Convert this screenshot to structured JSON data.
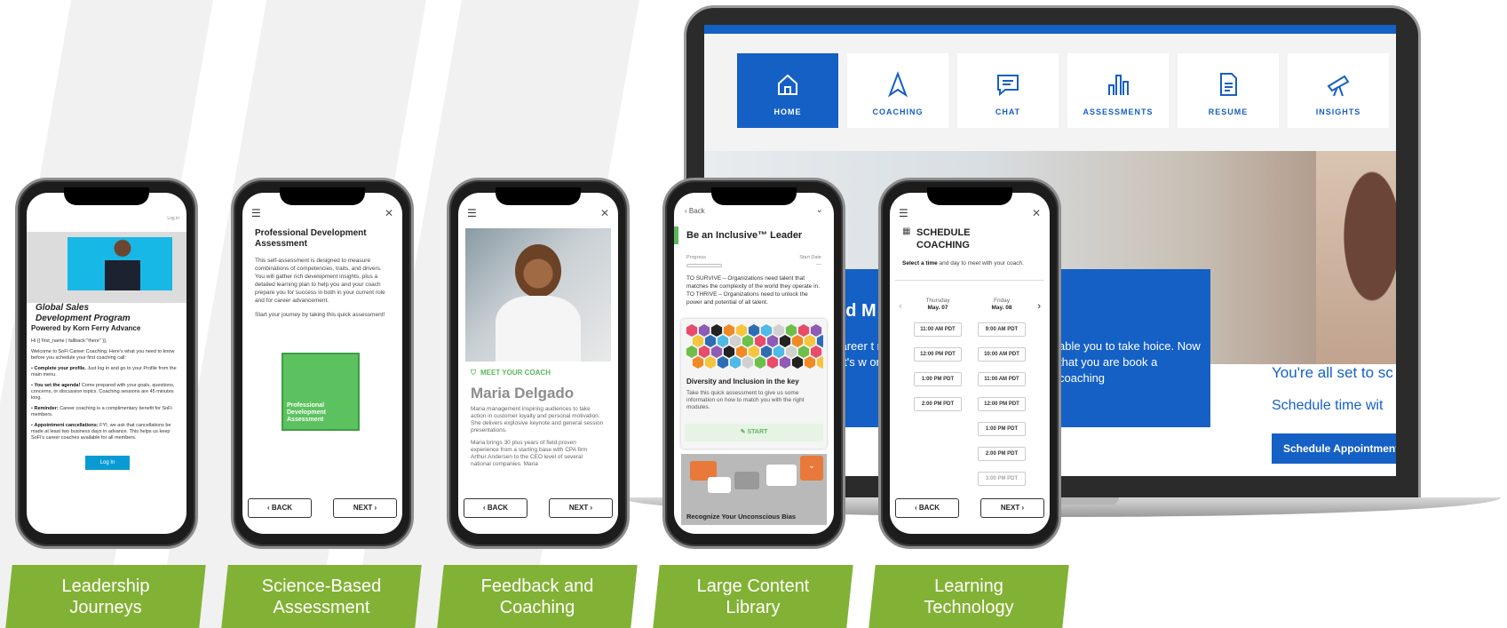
{
  "captions": [
    {
      "line1": "Leadership",
      "line2": "Journeys"
    },
    {
      "line1": "Science-Based",
      "line2": "Assessment"
    },
    {
      "line1": "Feedback and",
      "line2": "Coaching"
    },
    {
      "line1": "Large Content",
      "line2": "Library"
    },
    {
      "line1": "Learning",
      "line2": "Technology"
    }
  ],
  "laptop": {
    "nav": [
      {
        "label": "HOME",
        "icon": "home-icon"
      },
      {
        "label": "COACHING",
        "icon": "navigation-arrow-icon"
      },
      {
        "label": "CHAT",
        "icon": "chat-icon"
      },
      {
        "label": "ASSESSMENTS",
        "icon": "bar-chart-icon"
      },
      {
        "label": "RESUME",
        "icon": "document-icon"
      },
      {
        "label": "INSIGHTS",
        "icon": "telescope-icon"
      }
    ],
    "panel_heading": "od M",
    "panel_left": "career t ningful let's w on, sta",
    "panel_right": "able you to take hoice. Now that you are book a coaching",
    "allset": "You're all set to sc",
    "schedule_time": "Schedule time wit",
    "schedule_button": "Schedule Appointment"
  },
  "phone1": {
    "login_link": "Log in",
    "title_line1": "Global Sales",
    "title_line2": "Development Program",
    "subtitle": "Powered by Korn Ferry Advance",
    "greeting": "Hi {{ first_name | fallback:\"there\" }},",
    "welcome": "Welcome to SoFi Career Coaching. Here's what you need to know before you schedule your first coaching call:",
    "items": [
      {
        "bold": "Complete your profile.",
        "text": " Just log in and go to your Profile from the main menu."
      },
      {
        "bold": "You set the agenda!",
        "text": " Come prepared with your goals, questions, concerns, or discussion topics. Coaching sessions are 45 minutes long."
      },
      {
        "bold": "Reminder:",
        "text": " Career coaching is a complimentary benefit for SoFi members."
      },
      {
        "bold": "Appointment cancellations:",
        "text": " FYI, we ask that cancellations be made at least two business days in advance. This helps us keep SoFi's career coaches available for all members."
      }
    ],
    "login_button": "Log In"
  },
  "phone2": {
    "title": "Professional Development Assessment",
    "body1": "This self-assessment is designed to measure combinations of competencies, traits, and drivers. You will gather rich development insights, plus a detailed learning plan to help you and your coach prepare you for success in both in your current role and for career advancement.",
    "body2": "Start your journey by taking this quick assessment!",
    "card": "Professional Development Assessment",
    "back": "BACK",
    "next": "NEXT"
  },
  "phone3": {
    "meet": "MEET YOUR COACH",
    "name": "Maria Delgado",
    "body1": "Maria management inspiring audiences to take action in customer loyalty and personal motivation. She delivers explosive keynote and general session presentations.",
    "body2": "Maria brings 30 plus years of field proven experience from a starting base with CPA firm Arthur Andersen to the CEO level of several national companies. Maria",
    "back": "BACK",
    "next": "NEXT"
  },
  "phone4": {
    "back": "Back",
    "title": "Be an Inclusive™ Leader",
    "progress_label": "Progress",
    "start_date_label": "Start Date",
    "start_date_value": "---",
    "body": "TO SURVIVE – Organizations need talent that matches the complexity of the world they operate in. TO THRIVE – Organizations need to unlock the power and potential of all talent.",
    "card_title": "Diversity and Inclusion in the key",
    "card_body": "Take this quick assessment to give us some information on how to match you with the right modules.",
    "start": "START",
    "card2_title": "Recognize Your Unconscious Bias"
  },
  "phone5": {
    "title": "SCHEDULE COACHING",
    "sub_bold": "Select a time",
    "sub_rest": " and day to meet with your coach.",
    "day1_name": "Thursday",
    "day1_date": "May. 07",
    "day2_name": "Friday",
    "day2_date": "May. 08",
    "day1_slots": [
      "11:00 AM PDT",
      "12:00 PM PDT",
      "1:00 PM PDT",
      "2:00 PM PDT"
    ],
    "day2_slots": [
      "9:00 AM PDT",
      "10:00 AM PDT",
      "11:00 AM PDT",
      "12:00 PM PDT",
      "1:00 PM PDT",
      "2:00 PM PDT",
      "3:00 PM PDT"
    ],
    "back": "BACK",
    "next": "NEXT"
  },
  "colors": {
    "brand_blue": "#1560c4",
    "caption_green": "#82b235",
    "accent_green": "#5cb85c"
  }
}
